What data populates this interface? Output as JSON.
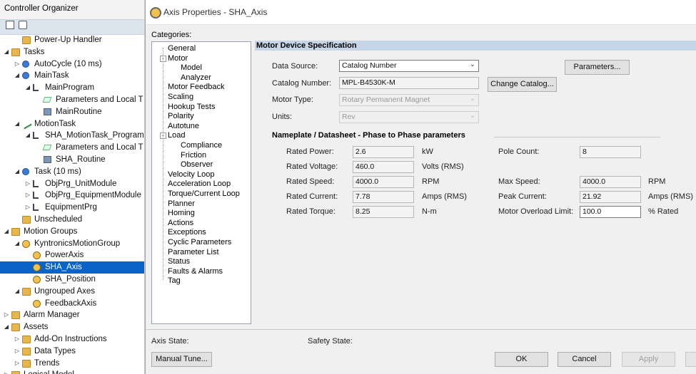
{
  "organizer": {
    "title": "Controller Organizer",
    "tree": [
      {
        "label": "Power-Up Handler",
        "indent": 2,
        "icon": "folder",
        "exp": ""
      },
      {
        "label": "Tasks",
        "indent": 1,
        "icon": "folder",
        "exp": "open"
      },
      {
        "label": "AutoCycle (10 ms)",
        "indent": 2,
        "icon": "clock",
        "exp": "closed"
      },
      {
        "label": "MainTask",
        "indent": 2,
        "icon": "clock",
        "exp": "open"
      },
      {
        "label": "MainProgram",
        "indent": 3,
        "icon": "prog",
        "exp": "open"
      },
      {
        "label": "Parameters and Local T",
        "indent": 4,
        "icon": "tag",
        "exp": ""
      },
      {
        "label": "MainRoutine",
        "indent": 4,
        "icon": "routine",
        "exp": ""
      },
      {
        "label": "MotionTask",
        "indent": 2,
        "icon": "motion",
        "exp": "open"
      },
      {
        "label": "SHA_MotionTask_Program",
        "indent": 3,
        "icon": "prog",
        "exp": "open"
      },
      {
        "label": "Parameters and Local T",
        "indent": 4,
        "icon": "tag",
        "exp": ""
      },
      {
        "label": "SHA_Routine",
        "indent": 4,
        "icon": "routine",
        "exp": ""
      },
      {
        "label": "Task (10 ms)",
        "indent": 2,
        "icon": "clock",
        "exp": "open"
      },
      {
        "label": "ObjPrg_UnitModule",
        "indent": 3,
        "icon": "prog",
        "exp": "closed"
      },
      {
        "label": "ObjPrg_EquipmentModule",
        "indent": 3,
        "icon": "prog",
        "exp": "closed"
      },
      {
        "label": "EquipmentPrg",
        "indent": 3,
        "icon": "prog",
        "exp": "closed"
      },
      {
        "label": "Unscheduled",
        "indent": 2,
        "icon": "folder",
        "exp": ""
      },
      {
        "label": "Motion Groups",
        "indent": 1,
        "icon": "folder",
        "exp": "open"
      },
      {
        "label": "KyntronicsMotionGroup",
        "indent": 2,
        "icon": "axis",
        "exp": "open"
      },
      {
        "label": "PowerAxis",
        "indent": 3,
        "icon": "axis",
        "exp": ""
      },
      {
        "label": "SHA_Axis",
        "indent": 3,
        "icon": "axis",
        "exp": "",
        "selected": true
      },
      {
        "label": "SHA_Position",
        "indent": 3,
        "icon": "axis",
        "exp": ""
      },
      {
        "label": "Ungrouped Axes",
        "indent": 2,
        "icon": "folder",
        "exp": "open"
      },
      {
        "label": "FeedbackAxis",
        "indent": 3,
        "icon": "axis",
        "exp": ""
      },
      {
        "label": "Alarm Manager",
        "indent": 1,
        "icon": "folder",
        "exp": "closed"
      },
      {
        "label": "Assets",
        "indent": 1,
        "icon": "folder",
        "exp": "open"
      },
      {
        "label": "Add-On Instructions",
        "indent": 2,
        "icon": "folder",
        "exp": "closed"
      },
      {
        "label": "Data Types",
        "indent": 2,
        "icon": "folder",
        "exp": "closed"
      },
      {
        "label": "Trends",
        "indent": 2,
        "icon": "folder",
        "exp": "closed"
      },
      {
        "label": "Logical Model",
        "indent": 1,
        "icon": "folder",
        "exp": "closed"
      }
    ]
  },
  "dialog": {
    "title": "Axis Properties - SHA_Axis",
    "categories_label": "Categories:",
    "categories": [
      {
        "label": "General",
        "level": 0,
        "exp": ""
      },
      {
        "label": "Motor",
        "level": 0,
        "exp": "-"
      },
      {
        "label": "Model",
        "level": 1,
        "exp": ""
      },
      {
        "label": "Analyzer",
        "level": 1,
        "exp": ""
      },
      {
        "label": "Motor Feedback",
        "level": 0,
        "exp": ""
      },
      {
        "label": "Scaling",
        "level": 0,
        "exp": ""
      },
      {
        "label": "Hookup Tests",
        "level": 0,
        "exp": ""
      },
      {
        "label": "Polarity",
        "level": 0,
        "exp": ""
      },
      {
        "label": "Autotune",
        "level": 0,
        "exp": ""
      },
      {
        "label": "Load",
        "level": 0,
        "exp": "-"
      },
      {
        "label": "Compliance",
        "level": 1,
        "exp": ""
      },
      {
        "label": "Friction",
        "level": 1,
        "exp": ""
      },
      {
        "label": "Observer",
        "level": 1,
        "exp": ""
      },
      {
        "label": "Velocity Loop",
        "level": 0,
        "exp": ""
      },
      {
        "label": "Acceleration Loop",
        "level": 0,
        "exp": ""
      },
      {
        "label": "Torque/Current Loop",
        "level": 0,
        "exp": ""
      },
      {
        "label": "Planner",
        "level": 0,
        "exp": ""
      },
      {
        "label": "Homing",
        "level": 0,
        "exp": ""
      },
      {
        "label": "Actions",
        "level": 0,
        "exp": ""
      },
      {
        "label": "Exceptions",
        "level": 0,
        "exp": ""
      },
      {
        "label": "Cyclic Parameters",
        "level": 0,
        "exp": ""
      },
      {
        "label": "Parameter List",
        "level": 0,
        "exp": ""
      },
      {
        "label": "Status",
        "level": 0,
        "exp": ""
      },
      {
        "label": "Faults & Alarms",
        "level": 0,
        "exp": ""
      },
      {
        "label": "Tag",
        "level": 0,
        "exp": ""
      }
    ],
    "section_title": "Motor Device Specification",
    "data_source_label": "Data Source:",
    "data_source_value": "Catalog Number",
    "parameters_button": "Parameters...",
    "catalog_label": "Catalog Number:",
    "catalog_value": "MPL-B4530K-M",
    "change_catalog_button": "Change Catalog...",
    "motor_type_label": "Motor Type:",
    "motor_type_value": "Rotary Permanent Magnet",
    "units_label": "Units:",
    "units_value": "Rev",
    "nameplate_title": "Nameplate / Datasheet - Phase to Phase parameters",
    "left_params": [
      {
        "label": "Rated Power:",
        "value": "2.6",
        "unit": "kW"
      },
      {
        "label": "Rated Voltage:",
        "value": "460.0",
        "unit": "Volts (RMS)"
      },
      {
        "label": "Rated Speed:",
        "value": "4000.0",
        "unit": "RPM"
      },
      {
        "label": "Rated Current:",
        "value": "7.78",
        "unit": "Amps (RMS)"
      },
      {
        "label": "Rated Torque:",
        "value": "8.25",
        "unit": "N-m"
      }
    ],
    "right_params": [
      {
        "label": "Pole Count:",
        "value": "8",
        "unit": ""
      },
      {
        "label": "Max Speed:",
        "value": "4000.0",
        "unit": "RPM"
      },
      {
        "label": "Peak Current:",
        "value": "21.92",
        "unit": "Amps (RMS)"
      },
      {
        "label": "Motor Overload Limit:",
        "value": "100.0",
        "unit": "% Rated"
      }
    ],
    "axis_state_label": "Axis State:",
    "safety_state_label": "Safety State:",
    "buttons": {
      "manual_tune": "Manual Tune...",
      "ok": "OK",
      "cancel": "Cancel",
      "apply": "Apply"
    }
  }
}
